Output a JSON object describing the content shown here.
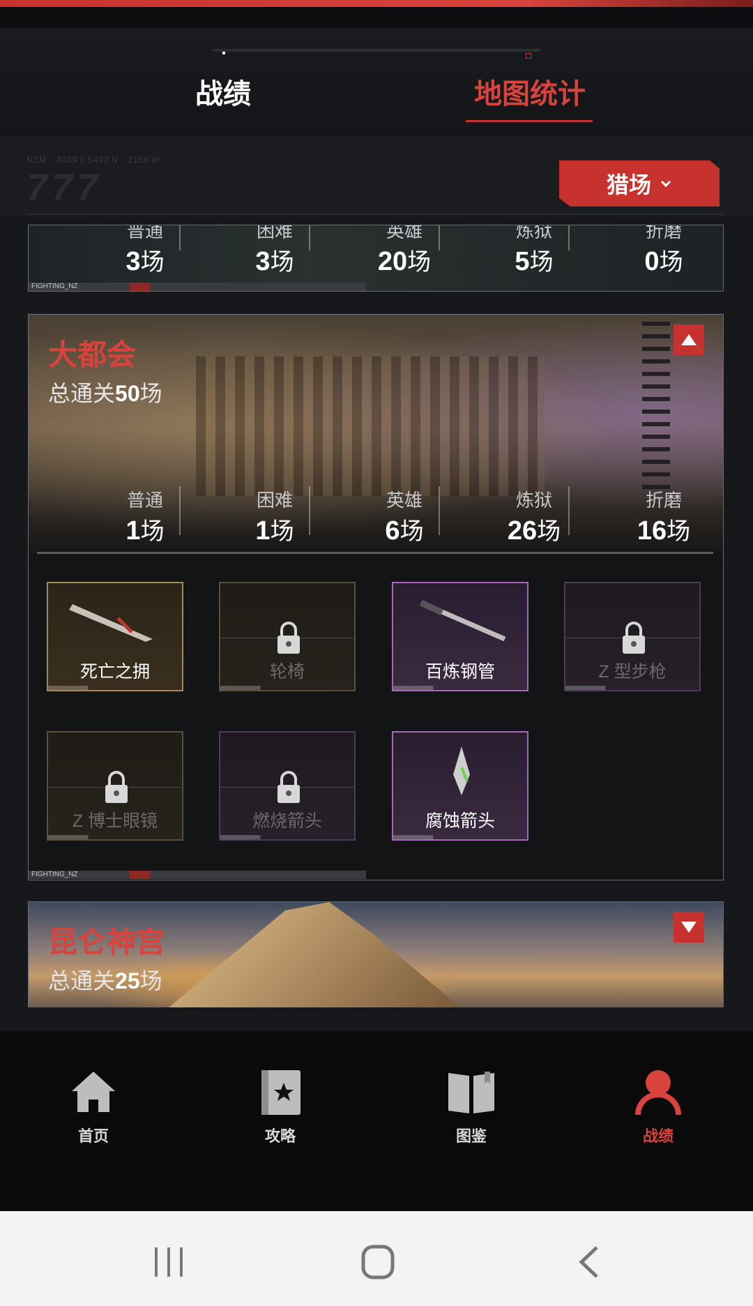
{
  "tabs": {
    "record": "战绩",
    "map_stats": "地图统计"
  },
  "filter": {
    "selected": "猎场",
    "logo_caption": "NZM · 3039's 5403'N · 2156'W",
    "logo_mark": "777"
  },
  "map_card_top": {
    "stats": [
      {
        "label": "普通",
        "value": "3",
        "unit": "场"
      },
      {
        "label": "困难",
        "value": "3",
        "unit": "场"
      },
      {
        "label": "英雄",
        "value": "20",
        "unit": "场"
      },
      {
        "label": "炼狱",
        "value": "5",
        "unit": "场"
      },
      {
        "label": "折磨",
        "value": "0",
        "unit": "场"
      }
    ],
    "footer": "FIGHTING_NZ"
  },
  "map_card_metropolis": {
    "name": "大都会",
    "total_prefix": "总通关",
    "total_value": "50",
    "total_unit": "场",
    "stats": [
      {
        "label": "普通",
        "value": "1",
        "unit": "场"
      },
      {
        "label": "困难",
        "value": "1",
        "unit": "场"
      },
      {
        "label": "英雄",
        "value": "6",
        "unit": "场"
      },
      {
        "label": "炼狱",
        "value": "26",
        "unit": "场"
      },
      {
        "label": "折磨",
        "value": "16",
        "unit": "场"
      }
    ],
    "items": [
      {
        "name": "死亡之拥",
        "rarity": "gold",
        "locked": false
      },
      {
        "name": "轮椅",
        "rarity": "gold",
        "locked": true
      },
      {
        "name": "百炼钢管",
        "rarity": "purple",
        "locked": false
      },
      {
        "name": "Z 型步枪",
        "rarity": "purple",
        "locked": true
      },
      {
        "name": "Z 博士眼镜",
        "rarity": "gold",
        "locked": true
      },
      {
        "name": "燃烧箭头",
        "rarity": "purple",
        "locked": true
      },
      {
        "name": "腐蚀箭头",
        "rarity": "purple",
        "locked": false
      }
    ],
    "footer": "FIGHTING_NZ"
  },
  "map_card_kunlun": {
    "name": "昆仑神宫",
    "total_prefix": "总通关",
    "total_value": "25",
    "total_unit": "场"
  },
  "bottom_nav": [
    {
      "label": "首页",
      "icon": "home-icon",
      "active": false
    },
    {
      "label": "攻略",
      "icon": "guide-book-icon",
      "active": false
    },
    {
      "label": "图鉴",
      "icon": "open-book-icon",
      "active": false
    },
    {
      "label": "战绩",
      "icon": "user-icon",
      "active": true
    }
  ],
  "colors": {
    "accent": "#d8433c",
    "accent_dark": "#c8322e",
    "gold_border": "#a48a5a",
    "purple_border": "#a46ab8"
  }
}
